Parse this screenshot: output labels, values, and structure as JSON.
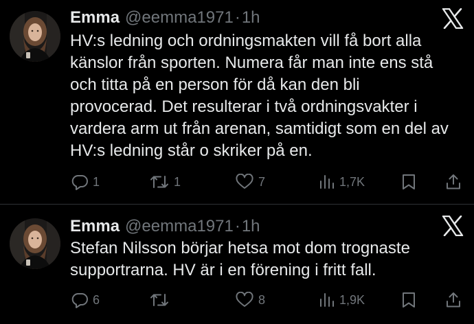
{
  "colors": {
    "background": "#000000",
    "text_primary": "#e7e9ea",
    "text_secondary": "#71767b",
    "divider": "#2f3336"
  },
  "icons": [
    "x-logo-icon",
    "reply-icon",
    "retweet-icon",
    "like-icon",
    "views-icon",
    "bookmark-icon",
    "share-icon"
  ],
  "tweets": [
    {
      "author": {
        "name": "Emma",
        "handle": "@eemma1971"
      },
      "separator": "·",
      "time": "1h",
      "text_lines": [
        "HV:s ledning och ordningsmakten vill få bort alla",
        "känslor från sporten. Numera får man inte ens stå",
        "och titta på en person för då kan den bli",
        "provocerad. Det resulterar i två ordningsvakter i",
        "vardera arm ut från arenan, samtidigt som en del av",
        "HV:s ledning står o skriker på en."
      ],
      "stats": {
        "replies": "1",
        "reposts": "1",
        "likes": "7",
        "views": "1,7K"
      }
    },
    {
      "author": {
        "name": "Emma",
        "handle": "@eemma1971"
      },
      "separator": "·",
      "time": "1h",
      "text_lines": [
        "Stefan Nilsson börjar hetsa mot dom trognaste",
        "supportrarna. HV är i en förening i fritt fall."
      ],
      "stats": {
        "replies": "6",
        "reposts": "",
        "likes": "8",
        "views": "1,9K"
      }
    }
  ]
}
